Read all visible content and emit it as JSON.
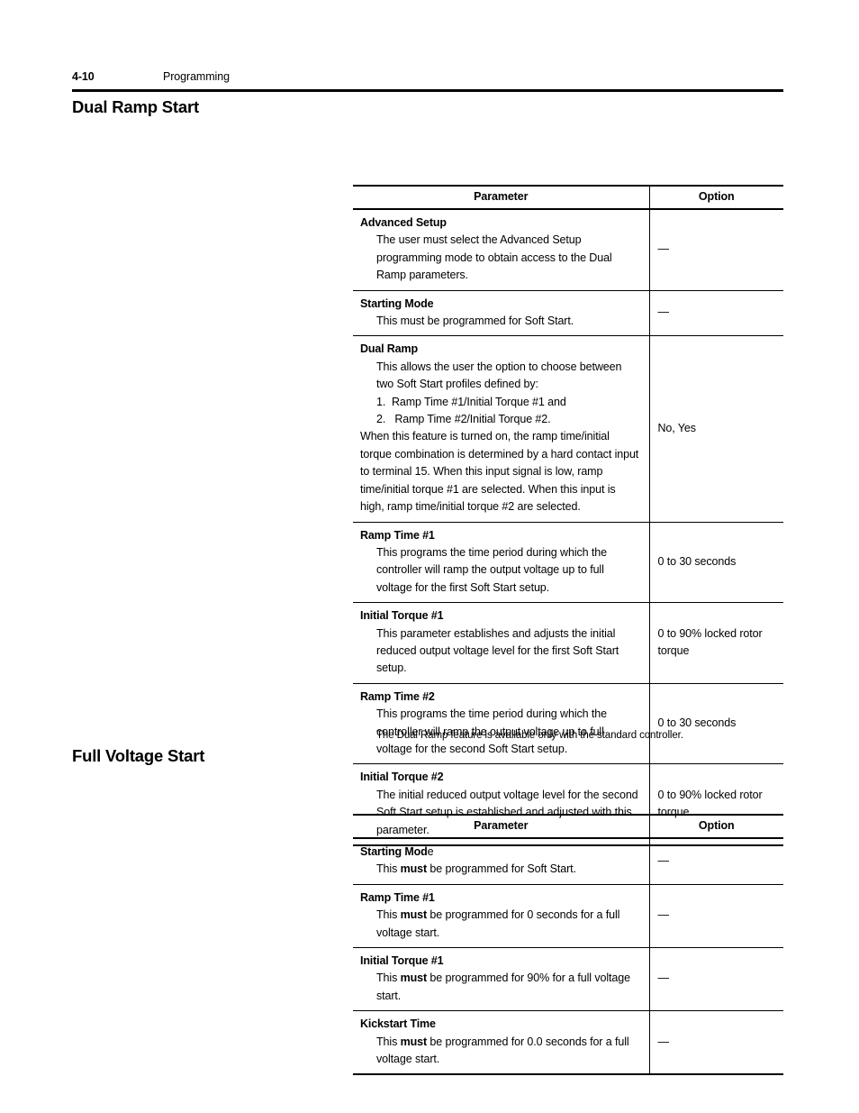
{
  "page": {
    "folio": "4-10",
    "chapter": "Programming"
  },
  "sections": [
    {
      "heading": "Dual Ramp Start",
      "table": {
        "columns": [
          "Parameter",
          "Option"
        ],
        "rows": [
          {
            "name": "Advanced Setup",
            "desc": "The user must select the Advanced Setup programming mode to obtain access to the Dual Ramp parameters.",
            "option": "—"
          },
          {
            "name": "Starting Mode",
            "desc": "This must be programmed for Soft Start.",
            "option": "—"
          },
          {
            "name": "Dual Ramp",
            "desc_before": "This allows the user the option to choose between two Soft Start profiles defined by:",
            "list": [
              "1.  Ramp Time #1/Initial Torque #1 and",
              "2.   Ramp Time #2/Initial Torque #2."
            ],
            "desc_after": "When this feature is turned on, the ramp time/initial torque combination is determined by a hard contact input to terminal 15.  When this input signal is low, ramp time/initial torque #1 are selected.  When this input is high, ramp time/initial torque #2 are selected.",
            "option": "No, Yes"
          },
          {
            "name": "Ramp Time #1",
            "desc": "This programs the time period during which the controller will ramp the output voltage up to full voltage for the first Soft Start setup.",
            "option": "0 to 30 seconds"
          },
          {
            "name": "Initial Torque #1",
            "desc": "This parameter establishes and adjusts the initial reduced output voltage level for the first Soft Start setup.",
            "option": "0 to 90% locked rotor torque"
          },
          {
            "name": "Ramp Time #2",
            "desc": "This programs the time period during which the controller will ramp the output voltage up to full voltage for the second Soft Start setup.",
            "option": "0 to 30 seconds"
          },
          {
            "name": "Initial Torque #2",
            "desc": "The initial reduced output voltage level for the second Soft Start setup is established and adjusted with this parameter.",
            "option": "0 to 90% locked rotor torque"
          }
        ],
        "note": "The Dual Ramp feature is available only with the standard controller."
      }
    },
    {
      "heading": "Full Voltage Start",
      "table": {
        "columns": [
          "Parameter",
          "Option"
        ],
        "rows": [
          {
            "name_bold": "Starting Mod",
            "name_tail": "e",
            "desc_pre": "This ",
            "desc_bold": "must",
            "desc_post": " be programmed for Soft Start.",
            "option": "—"
          },
          {
            "name_bold": "Ramp Time #1",
            "name_tail": "",
            "desc_pre": "This ",
            "desc_bold": "must",
            "desc_post": " be programmed for 0 seconds for a full voltage start.",
            "option": "—"
          },
          {
            "name_bold": "Initial Torque #1",
            "name_tail": "",
            "desc_pre": "This ",
            "desc_bold": "must",
            "desc_post": " be programmed for 90% for a full voltage start.",
            "option": "—"
          },
          {
            "name_bold": "Kickstart Time",
            "name_tail": "",
            "desc_pre": "This ",
            "desc_bold": "must",
            "desc_post": " be programmed for 0.0 seconds for a full voltage start.",
            "option": "—"
          }
        ]
      }
    }
  ]
}
